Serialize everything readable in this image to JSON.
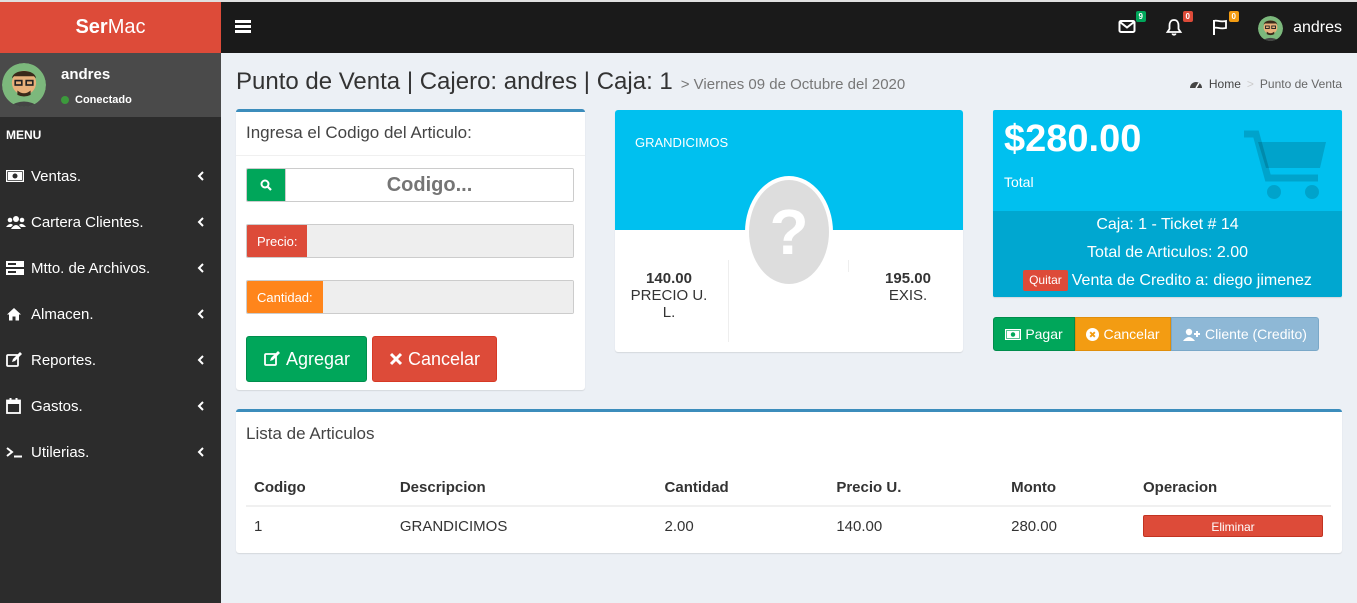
{
  "app": {
    "logo_bold": "Ser",
    "logo_rest": "Mac"
  },
  "navbar": {
    "menu_icon": "hamburger-icon",
    "mail_badge": "9",
    "bell_badge": "0",
    "flag_badge": "0",
    "user_name": "andres",
    "colors": {
      "mail": "#00a65a",
      "bell": "#dd4b39",
      "flag": "#f39c12"
    }
  },
  "sidebar": {
    "user": {
      "name": "andres",
      "status": "Conectado"
    },
    "menu_header": "MENU",
    "items": [
      {
        "label": "Ventas.",
        "icon": "money-icon"
      },
      {
        "label": "Cartera Clientes.",
        "icon": "users-icon"
      },
      {
        "label": "Mtto. de Archivos.",
        "icon": "server-icon"
      },
      {
        "label": "Almacen.",
        "icon": "home-icon"
      },
      {
        "label": "Reportes.",
        "icon": "edit-icon"
      },
      {
        "label": "Gastos.",
        "icon": "calendar-icon"
      },
      {
        "label": "Utilerias.",
        "icon": "terminal-icon"
      }
    ]
  },
  "header": {
    "title": "Punto de Venta | Cajero: andres | Caja: 1",
    "subtitle": "> Viernes 09 de Octubre del 2020",
    "breadcrumb_home": "Home",
    "breadcrumb_current": "Punto de Venta"
  },
  "code_box": {
    "title": "Ingresa el Codigo del Articulo:",
    "code_placeholder": "Codigo...",
    "price_label": "Precio:",
    "qty_label": "Cantidad:",
    "add_button": "Agregar",
    "cancel_button": "Cancelar"
  },
  "product": {
    "name": "GRANDICIMOS",
    "price_value": "140.00",
    "price_label": "PRECIO U. L.",
    "stock_value": "195.00",
    "stock_label": "EXIS.",
    "image_placeholder": "?"
  },
  "total": {
    "amount": "$280.00",
    "label": "Total",
    "caja_ticket": "Caja: 1 - Ticket # 14",
    "total_articles": "Total de Articulos: 2.00",
    "quitar": "Quitar",
    "credit_sale": "Venta de Credito a: diego jimenez",
    "pay_button": "Pagar",
    "cancel_button": "Cancelar",
    "client_button": "Cliente (Credito)"
  },
  "list": {
    "title": "Lista de Articulos",
    "columns": [
      "Codigo",
      "Descripcion",
      "Cantidad",
      "Precio U.",
      "Monto",
      "Operacion"
    ],
    "rows": [
      {
        "codigo": "1",
        "descripcion": "GRANDICIMOS",
        "cantidad": "2.00",
        "precio": "140.00",
        "monto": "280.00",
        "operacion": "Eliminar"
      }
    ]
  }
}
